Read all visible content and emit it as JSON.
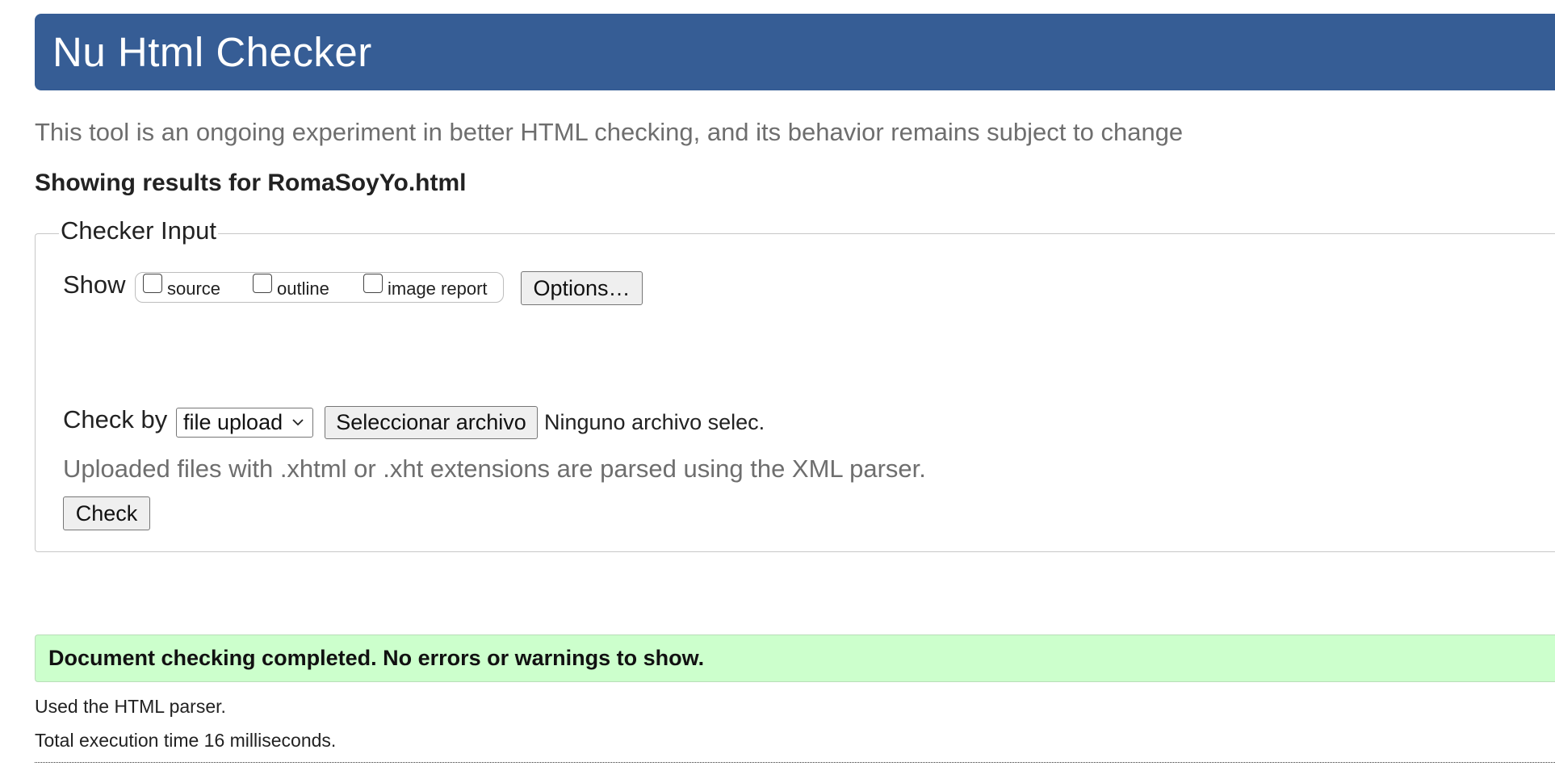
{
  "header": {
    "title": "Nu Html Checker",
    "background_color": "#365d95"
  },
  "tagline": "This tool is an ongoing experiment in better HTML checking, and its behavior remains subject to change",
  "results_heading": "Showing results for RomaSoyYo.html",
  "checker_input": {
    "legend": "Checker Input",
    "show_label": "Show",
    "show_options": [
      {
        "label": "source",
        "checked": false
      },
      {
        "label": "outline",
        "checked": false
      },
      {
        "label": "image report",
        "checked": false
      }
    ],
    "options_button": "Options…",
    "check_by_label": "Check by",
    "check_by_selected": "file upload",
    "file_button": "Seleccionar archivo",
    "file_status": "Ninguno archivo selec.",
    "xml_note": "Uploaded files with .xhtml or .xht extensions are parsed using the XML parser.",
    "check_button": "Check"
  },
  "results": {
    "success_message": "Document checking completed. No errors or warnings to show.",
    "success_color": "#ccffcc",
    "parser_note": "Used the HTML parser.",
    "execution_time": "Total execution time 16 milliseconds."
  }
}
